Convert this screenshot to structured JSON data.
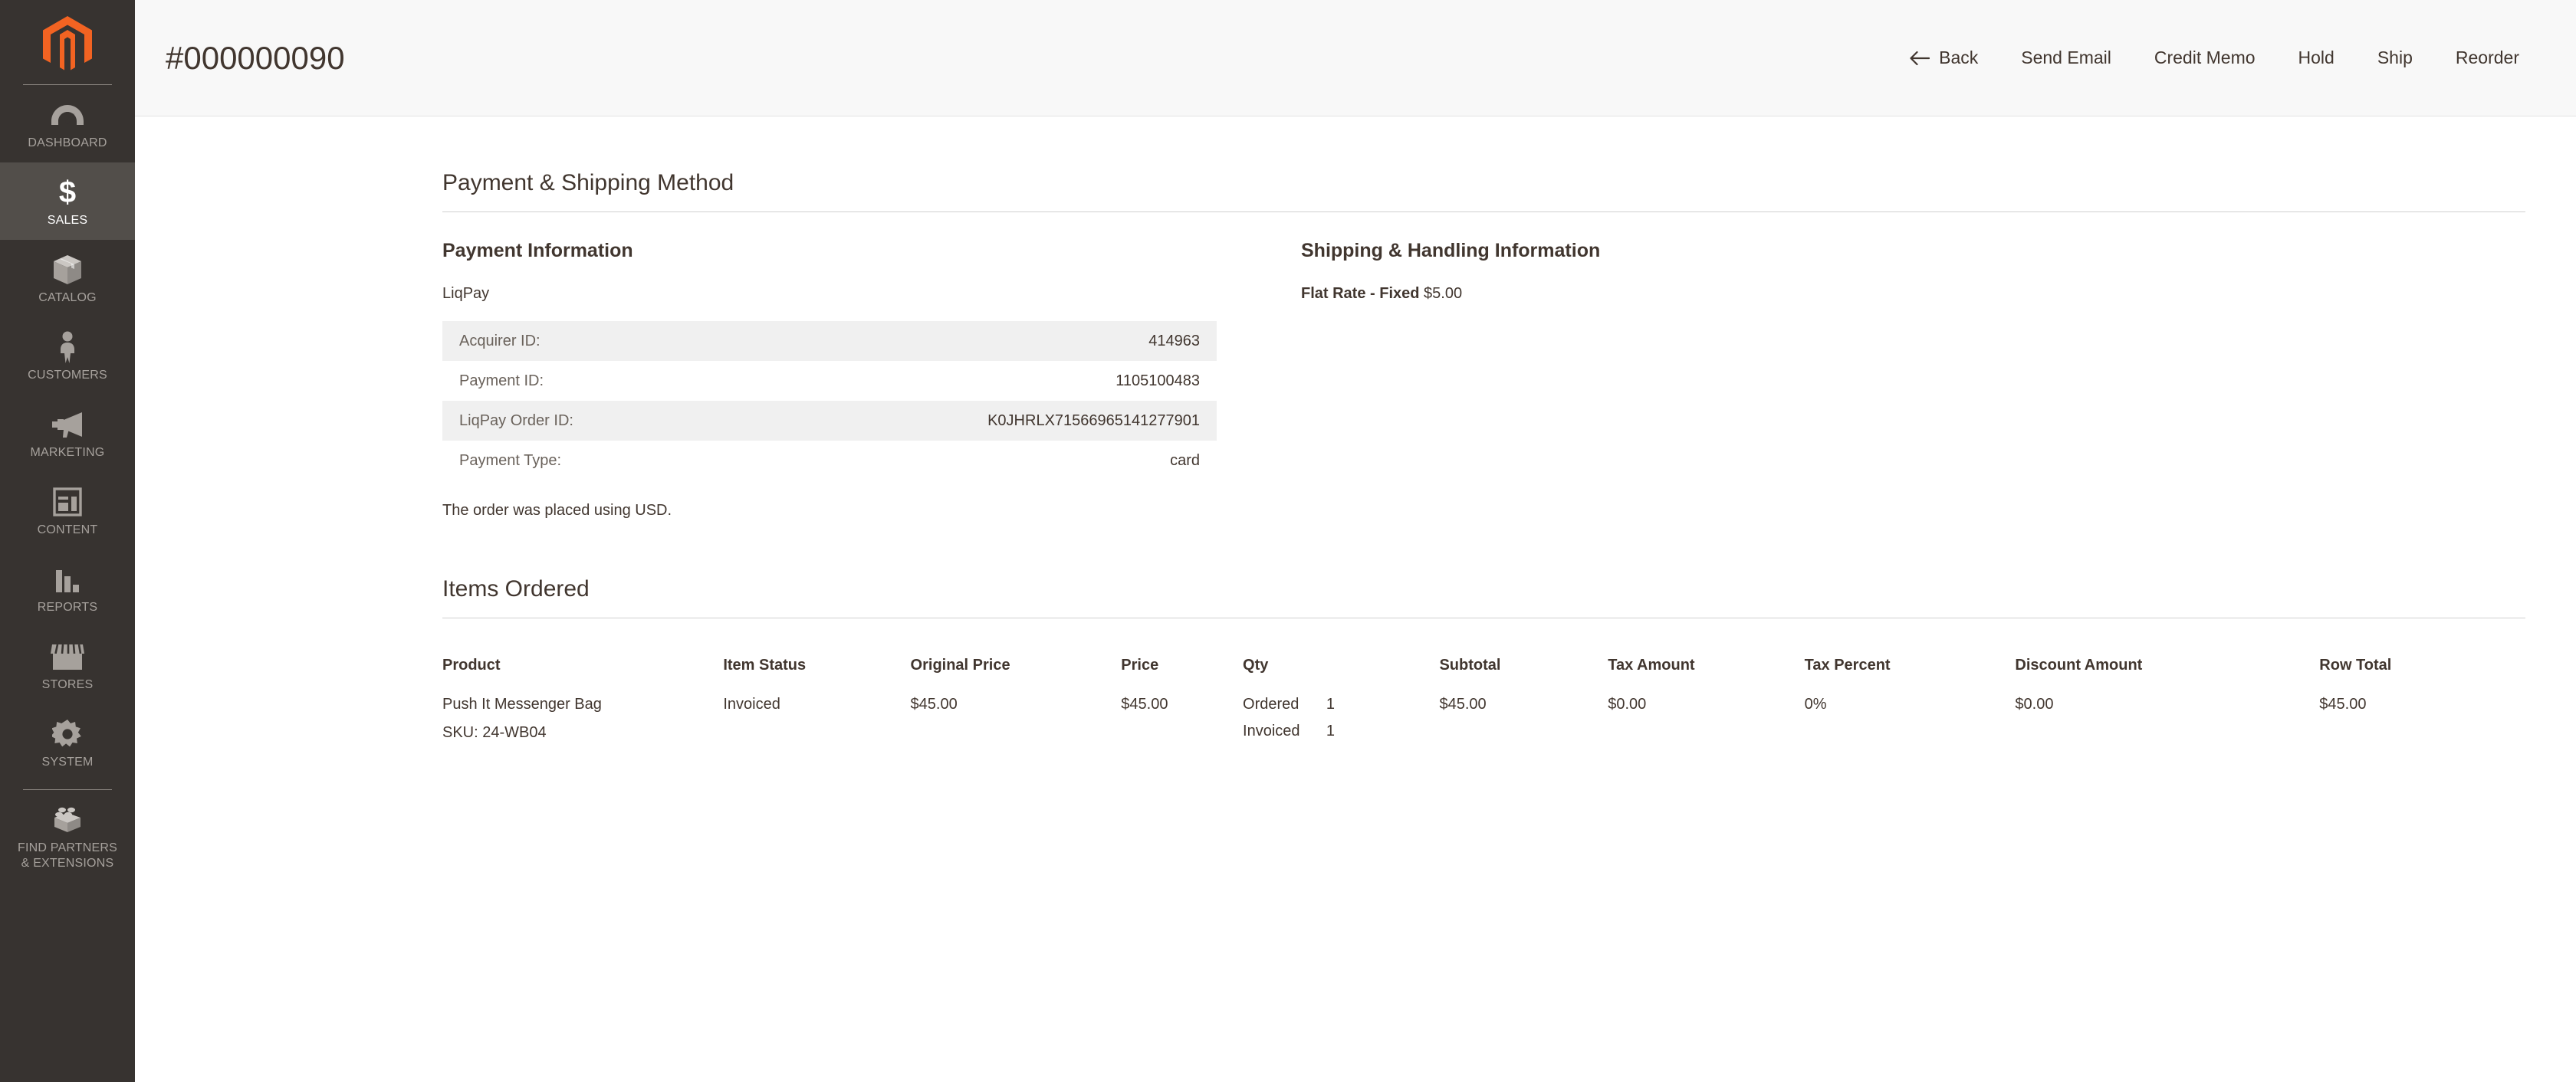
{
  "sidebar": {
    "logo": "magento-logo",
    "items": [
      {
        "label": "Dashboard",
        "icon": "dashboard-gauge-icon",
        "active": false
      },
      {
        "label": "Sales",
        "icon": "dollar-sign-icon",
        "active": true
      },
      {
        "label": "Catalog",
        "icon": "box-icon",
        "active": false
      },
      {
        "label": "Customers",
        "icon": "person-icon",
        "active": false
      },
      {
        "label": "Marketing",
        "icon": "megaphone-icon",
        "active": false
      },
      {
        "label": "Content",
        "icon": "layout-grid-icon",
        "active": false
      },
      {
        "label": "Reports",
        "icon": "bar-chart-icon",
        "active": false
      },
      {
        "label": "Stores",
        "icon": "storefront-icon",
        "active": false
      },
      {
        "label": "System",
        "icon": "gear-icon",
        "active": false
      }
    ],
    "partners": {
      "label_line1": "Find Partners",
      "label_line2": "& Extensions",
      "icon": "lego-brick-icon"
    }
  },
  "header": {
    "title": "#000000090",
    "actions": [
      {
        "label": "Back",
        "icon": "arrow-left-icon"
      },
      {
        "label": "Send Email",
        "icon": ""
      },
      {
        "label": "Credit Memo",
        "icon": ""
      },
      {
        "label": "Hold",
        "icon": ""
      },
      {
        "label": "Ship",
        "icon": ""
      },
      {
        "label": "Reorder",
        "icon": ""
      }
    ]
  },
  "payment_shipping": {
    "section_title": "Payment & Shipping Method",
    "payment": {
      "heading": "Payment Information",
      "method": "LiqPay",
      "rows": [
        {
          "label": "Acquirer ID:",
          "value": "414963"
        },
        {
          "label": "Payment ID:",
          "value": "1105100483"
        },
        {
          "label": "LiqPay Order ID:",
          "value": "K0JHRLX71566965141277901"
        },
        {
          "label": "Payment Type:",
          "value": "card"
        }
      ],
      "currency_note": "The order was placed using USD."
    },
    "shipping": {
      "heading": "Shipping & Handling Information",
      "method": "Flat Rate - Fixed",
      "amount": "$5.00"
    }
  },
  "items_ordered": {
    "section_title": "Items Ordered",
    "columns": [
      "Product",
      "Item Status",
      "Original Price",
      "Price",
      "Qty",
      "Subtotal",
      "Tax Amount",
      "Tax Percent",
      "Discount Amount",
      "Row Total"
    ],
    "rows": [
      {
        "product_name": "Push It Messenger Bag",
        "sku": "SKU: 24-WB04",
        "item_status": "Invoiced",
        "original_price": "$45.00",
        "price": "$45.00",
        "qty": [
          {
            "key": "Ordered",
            "value": "1"
          },
          {
            "key": "Invoiced",
            "value": "1"
          }
        ],
        "subtotal": "$45.00",
        "tax_amount": "$0.00",
        "tax_percent": "0%",
        "discount_amount": "$0.00",
        "row_total": "$45.00"
      }
    ]
  },
  "colors": {
    "sidebar_bg": "#373330",
    "sidebar_active_bg": "#524e4a",
    "brand_orange": "#f26322",
    "header_bg": "#f8f8f8",
    "text": "#41362f",
    "row_stripe": "#f0f0f0"
  }
}
